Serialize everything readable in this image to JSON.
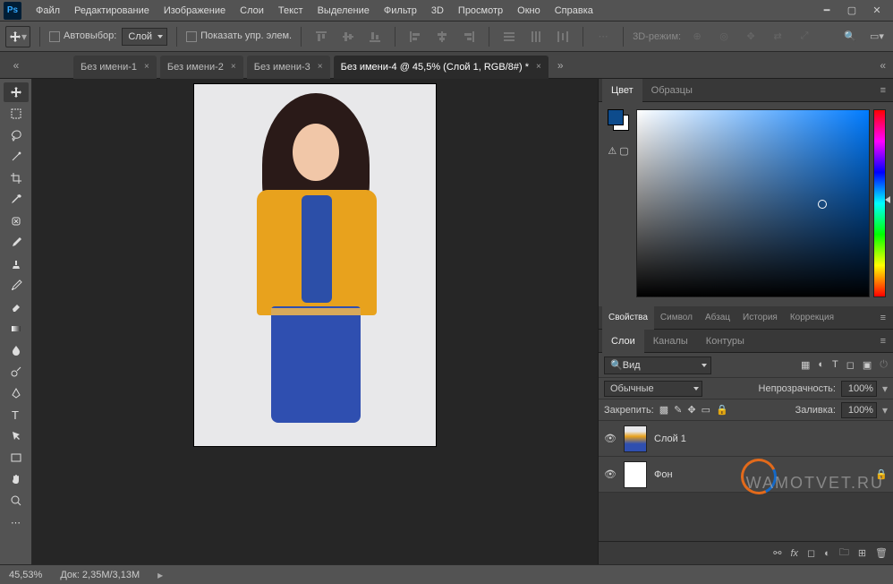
{
  "menu": [
    "Файл",
    "Редактирование",
    "Изображение",
    "Слои",
    "Текст",
    "Выделение",
    "Фильтр",
    "3D",
    "Просмотр",
    "Окно",
    "Справка"
  ],
  "optionBar": {
    "autoSelectLabel": "Автовыбор:",
    "autoSelectTarget": "Слой",
    "showTransformLabel": "Показать упр. элем.",
    "mode3d": "3D-режим:"
  },
  "tabs": [
    {
      "title": "Без имени-1"
    },
    {
      "title": "Без имени-2"
    },
    {
      "title": "Без имени-3"
    },
    {
      "title": "Без имени-4 @ 45,5% (Слой 1, RGB/8#) *",
      "active": true
    }
  ],
  "colorPanelTabs": [
    "Цвет",
    "Образцы"
  ],
  "midPanelTabs": [
    "Свойства",
    "Символ",
    "Абзац",
    "История",
    "Коррекция"
  ],
  "layersTabs": [
    "Слои",
    "Каналы",
    "Контуры"
  ],
  "layersPanel": {
    "filterKind": "Вид",
    "blendMode": "Обычные",
    "opacityLabel": "Непрозрачность:",
    "opacityValue": "100%",
    "lockLabel": "Закрепить:",
    "fillLabel": "Заливка:",
    "fillValue": "100%",
    "layers": [
      {
        "name": "Слой 1",
        "locked": false
      },
      {
        "name": "Фон",
        "locked": true
      }
    ]
  },
  "status": {
    "zoom": "45,53%",
    "doc": "Док: 2,35M/3,13M"
  },
  "watermark": "WAMOTVET.RU",
  "searchGlyph": "🔍"
}
